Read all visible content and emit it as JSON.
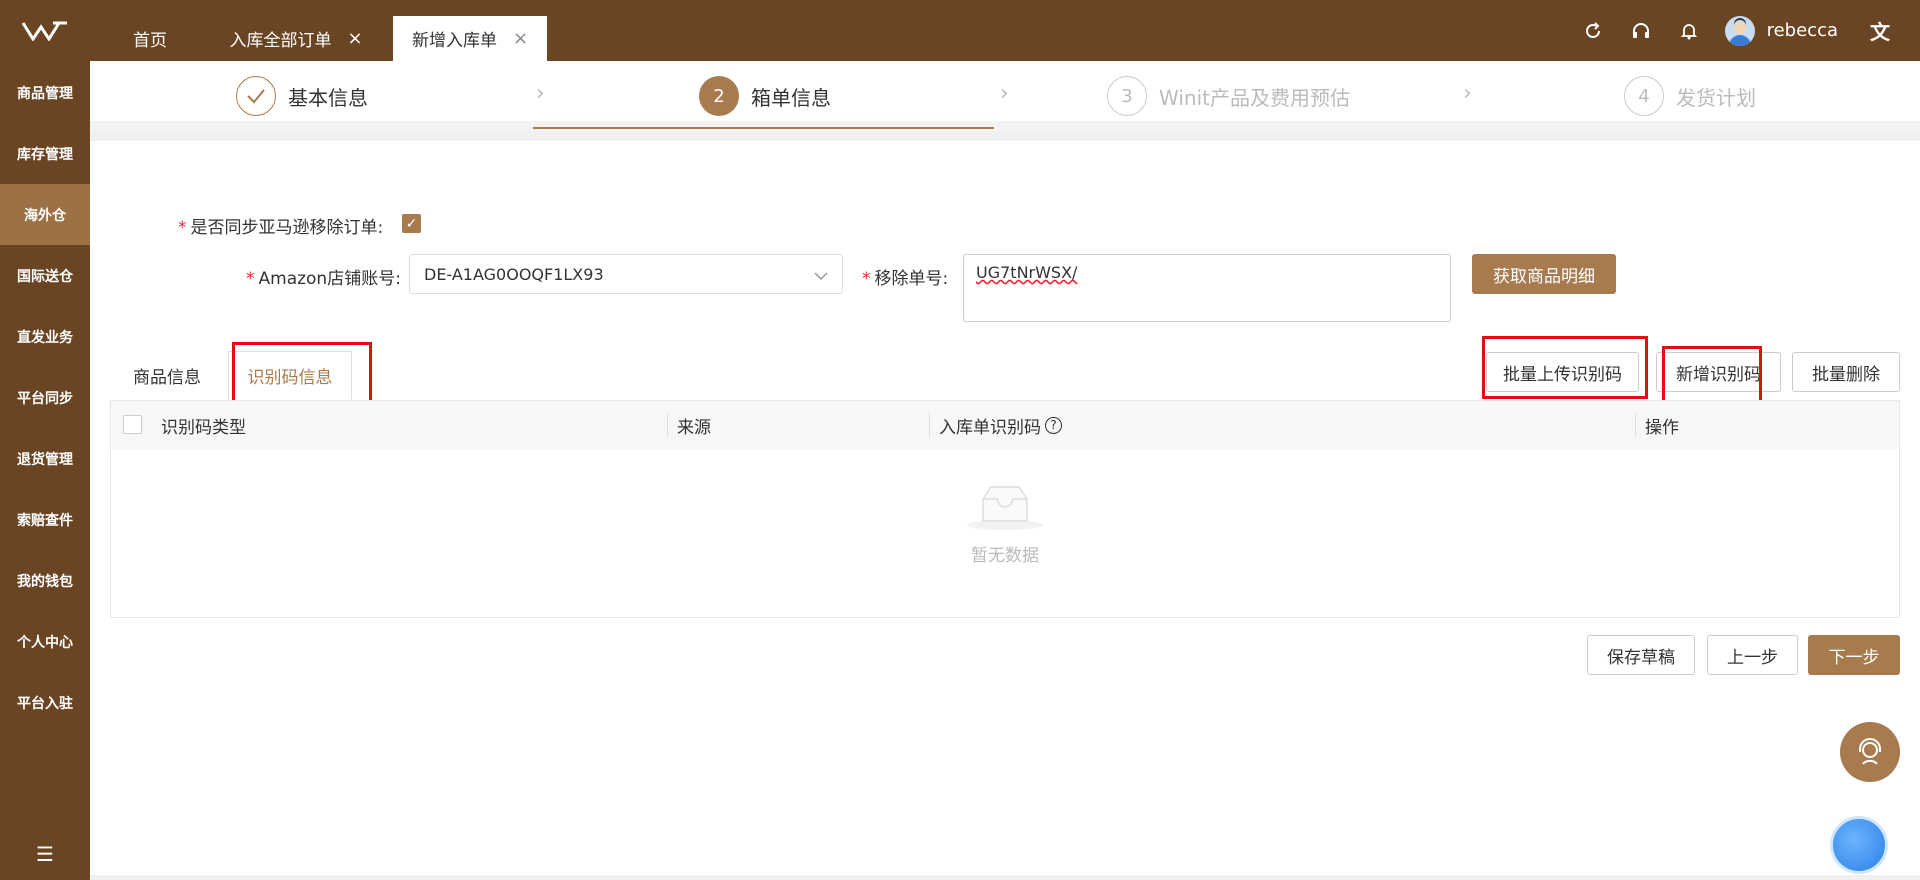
{
  "sidebar": {
    "items": [
      {
        "label": "商品管理"
      },
      {
        "label": "库存管理"
      },
      {
        "label": "海外仓"
      },
      {
        "label": "国际送仓"
      },
      {
        "label": "直发业务"
      },
      {
        "label": "平台同步"
      },
      {
        "label": "退货管理"
      },
      {
        "label": "索赔查件"
      },
      {
        "label": "我的钱包"
      },
      {
        "label": "个人中心"
      },
      {
        "label": "平台入驻"
      }
    ],
    "active_index": 2
  },
  "header": {
    "tabs": [
      {
        "label": "首页"
      },
      {
        "label": "入库全部订单",
        "close": "×"
      },
      {
        "label": "新增入库单",
        "close": "×"
      }
    ],
    "username": "rebecca",
    "icons": [
      "refresh-icon",
      "headset-icon",
      "bell-icon",
      "translate-icon"
    ]
  },
  "steps": [
    {
      "number": "",
      "label": "基本信息",
      "state": "done"
    },
    {
      "number": "2",
      "label": "箱单信息",
      "state": "current"
    },
    {
      "number": "3",
      "label": "Winit产品及费用预估",
      "state": "pending"
    },
    {
      "number": "4",
      "label": "发货计划",
      "state": "pending"
    }
  ],
  "form": {
    "sync_label": "是否同步亚马逊移除订单:",
    "sync_checked": true,
    "store_label": "Amazon店铺账号:",
    "store_value": "DE-A1AG0OOQF1LX93",
    "removal_label": "移除单号:",
    "removal_value": "UG7tNrWSX/",
    "fetch_button": "获取商品明细",
    "required_mark": "*"
  },
  "subtabs": [
    {
      "label": "商品信息"
    },
    {
      "label": "识别码信息"
    }
  ],
  "actions": {
    "batch_upload": "批量上传识别码",
    "add_code": "新增识别码",
    "batch_delete": "批量删除"
  },
  "table": {
    "columns": [
      "识别码类型",
      "来源",
      "入库单识别码",
      "操作"
    ],
    "empty_text": "暂无数据"
  },
  "footer": {
    "save_draft": "保存草稿",
    "prev": "上一步",
    "next": "下一步"
  },
  "colors": {
    "brand_dark": "#6a4524",
    "brand": "#a87b4f",
    "highlight_red": "#e01010"
  }
}
